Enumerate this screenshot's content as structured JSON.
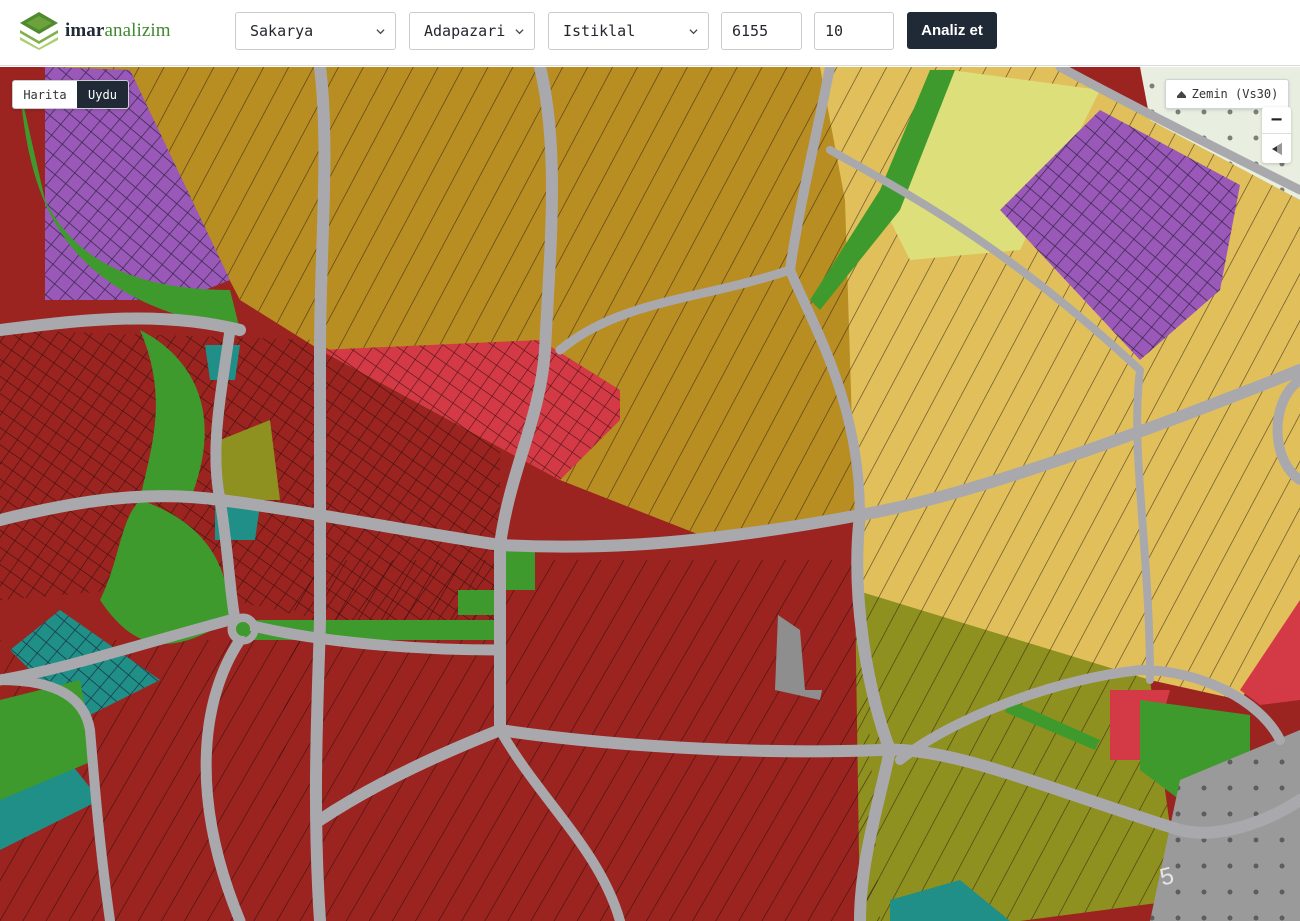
{
  "brand": {
    "name_bold": "imar",
    "name_light": "analizim",
    "colors": {
      "dark": "#1f2a36",
      "green": "#3f8a2e"
    }
  },
  "search": {
    "province": "Sakarya",
    "district": "Adapazari",
    "neighborhood": "Istiklal",
    "block": "6155",
    "parcel": "10",
    "submit_label": "Analiz et"
  },
  "map": {
    "view_toggle": {
      "map_label": "Harita",
      "satellite_label": "Uydu",
      "active": "Uydu"
    },
    "layer_button": {
      "icon": "layers-icon",
      "label": "Zemin (Vs30)"
    },
    "controls": {
      "zoom_out": "−",
      "compass_icon": "compass-icon"
    },
    "road_label": "5",
    "zone_colors": {
      "residential_dense": "#9b2420",
      "commercial": "#d43a46",
      "agricultural": "#b88d22",
      "housing_low": "#e1c05c",
      "park": "#3f9a2d",
      "public": "#9a58b8",
      "social": "#1f8f88",
      "light_yellow": "#dde07a",
      "olive": "#8e911f"
    }
  }
}
